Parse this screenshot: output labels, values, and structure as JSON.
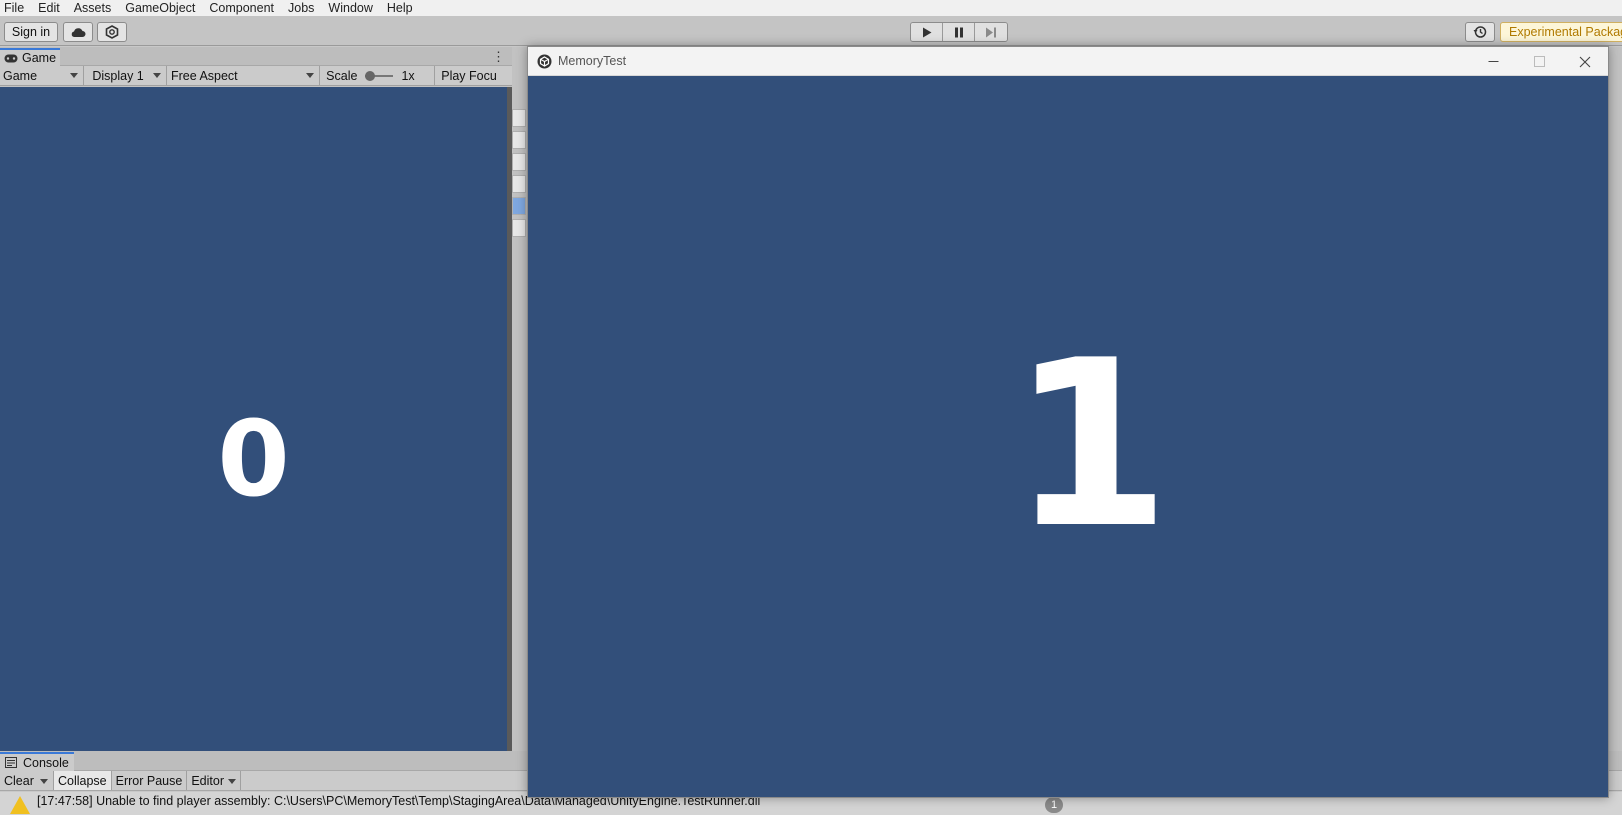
{
  "menubar": {
    "items": [
      "File",
      "Edit",
      "Assets",
      "GameObject",
      "Component",
      "Jobs",
      "Window",
      "Help"
    ]
  },
  "toolbar": {
    "signin_label": "Sign in",
    "experimental_label": "Experimental Packag"
  },
  "game_panel": {
    "tab_label": "Game",
    "mode": "Game",
    "display": "Display 1",
    "aspect": "Free Aspect",
    "scale_label": "Scale",
    "scale_value": "1x",
    "play_focus": "Play Focu",
    "number": "0"
  },
  "console": {
    "tab_label": "Console",
    "clear_label": "Clear",
    "collapse_label": "Collapse",
    "error_pause_label": "Error Pause",
    "editor_label": "Editor",
    "log_line": "[17:47:58] Unable to find player assembly: C:\\Users\\PC\\MemoryTest\\Temp\\StagingArea\\Data\\Managed\\UnityEngine.TestRunner.dll",
    "log_count": "1"
  },
  "memory_window": {
    "title": "MemoryTest",
    "number": "1"
  },
  "colors": {
    "game_background": "#324f7a",
    "warning": "#f0c020",
    "experimental_text": "#b07a00",
    "tab_accent": "#3a79d7"
  }
}
